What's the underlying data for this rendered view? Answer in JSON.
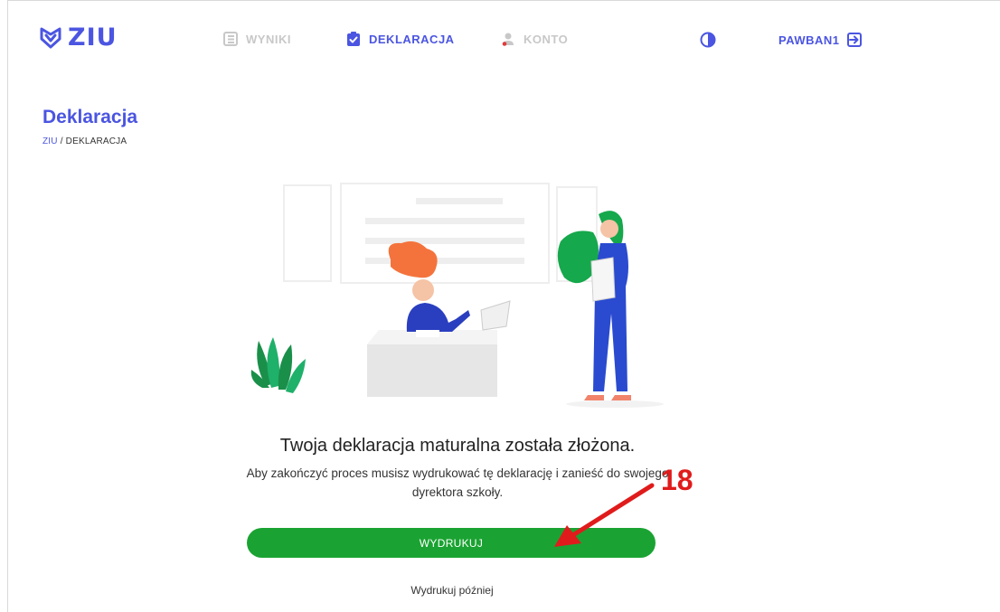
{
  "header": {
    "logo_text": "ZIU",
    "nav": [
      {
        "label": "WYNIKI",
        "icon": "list-document-icon",
        "active": false
      },
      {
        "label": "DEKLARACJA",
        "icon": "checked-clipboard-icon",
        "active": true
      },
      {
        "label": "KONTO",
        "icon": "person-icon",
        "active": false
      }
    ],
    "contrast_icon": "contrast-icon",
    "username": "PAWBAN1",
    "logout_icon": "logout-icon"
  },
  "page": {
    "title": "Deklaracja",
    "breadcrumb_root": "ZIU",
    "breadcrumb_separator": " / ",
    "breadcrumb_current": "DEKLARACJA"
  },
  "message": {
    "headline": "Twoja deklaracja maturalna została złożona.",
    "subline": "Aby zakończyć proces musisz wydrukować tę deklarację i zanieść do swojego dyrektora szkoły.",
    "print_button": "WYDRUKUJ",
    "later_link": "Wydrukuj później"
  },
  "annotation": {
    "number": "18",
    "color": "#e01b1b"
  },
  "colors": {
    "brand": "#4b55e1",
    "primary_button": "#1aa332",
    "inactive_nav": "#c8c8c8"
  }
}
